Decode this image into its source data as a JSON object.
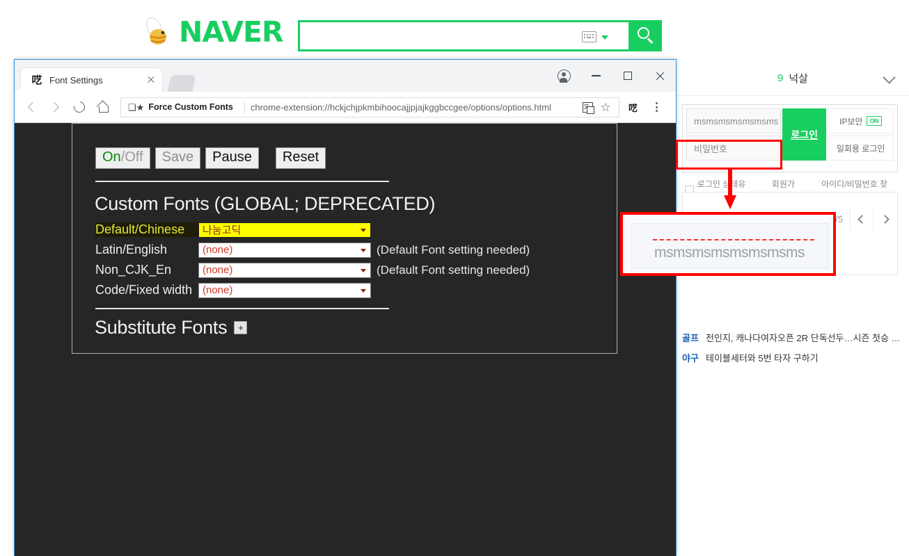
{
  "naver": {
    "logo_text": "NAVER",
    "logo_icon": "naver-bee-logo",
    "search_placeholder": "",
    "search_value": "",
    "keyboard_icon": "keyboard-icon",
    "search_icon": "magnifier-icon"
  },
  "right_column": {
    "trend_rank": "9",
    "trend_keyword": "넉살",
    "collapse_icon": "chevron-down-icon",
    "login": {
      "id_value": "msmsmsmsmsmsms",
      "password_placeholder": "비밀번호",
      "login_button": "로그인",
      "ip_security_label": "IP보안",
      "ip_security_state": "ON",
      "one_time_login": "일회용 로그인",
      "keep_login": "로그인 상태유지",
      "signup": "회원가입",
      "find_account": "아이디/비밀번호 찾기"
    },
    "pager": {
      "page_text": "/5",
      "prev_icon": "chevron-left-icon",
      "next_icon": "chevron-right-icon"
    },
    "news": [
      {
        "category": "골프",
        "title": "전인지, 캐나다여자오픈 2R 단독선두…시즌 첫승 …"
      },
      {
        "category": "야구",
        "title": "테이블세터와 5번 타자 구하기"
      }
    ]
  },
  "annotation": {
    "callout_text": "msmsmsmsmsmsmsms",
    "highlight_color": "#ff0000"
  },
  "browser": {
    "tab": {
      "favicon": "呓",
      "title": "Font Settings",
      "close_icon": "close-icon"
    },
    "window_controls": {
      "profile_icon": "profile-icon",
      "minimize_icon": "minimize-icon",
      "maximize_icon": "maximize-icon",
      "close_icon": "close-icon"
    },
    "toolbar": {
      "back_icon": "back-arrow-icon",
      "forward_icon": "forward-arrow-icon",
      "reload_icon": "reload-icon",
      "home_icon": "home-icon",
      "extension_chip_icon": "puzzle-piece-icon",
      "extension_chip_label": "Force Custom Fonts",
      "url": "chrome-extension://hckjchjpkmbihoocajjpjajkggbccgee/options/options.html",
      "translate_icon": "translate-icon",
      "bookmark_icon": "star-icon",
      "extension_icon": "extension-icon",
      "menu_icon": "kebab-menu-icon"
    }
  },
  "options_page": {
    "buttons": {
      "onoff_on": "On",
      "onoff_off": "/Off",
      "save": "Save",
      "pause": "Pause",
      "reset": "Reset"
    },
    "custom_fonts": {
      "heading": "Custom Fonts (GLOBAL; DEPRECATED)",
      "rows": [
        {
          "label": "Default/Chinese",
          "value": "나눔고딕",
          "note": "",
          "highlight": true
        },
        {
          "label": "Latin/English",
          "value": "(none)",
          "note": "(Default Font setting needed)",
          "highlight": false
        },
        {
          "label": "Non_CJK_En",
          "value": "(none)",
          "note": "(Default Font setting needed)",
          "highlight": false
        },
        {
          "label": "Code/Fixed width",
          "value": "(none)",
          "note": "",
          "highlight": false
        }
      ]
    },
    "substitute_fonts": {
      "heading": "Substitute Fonts",
      "add_button": "+"
    }
  }
}
